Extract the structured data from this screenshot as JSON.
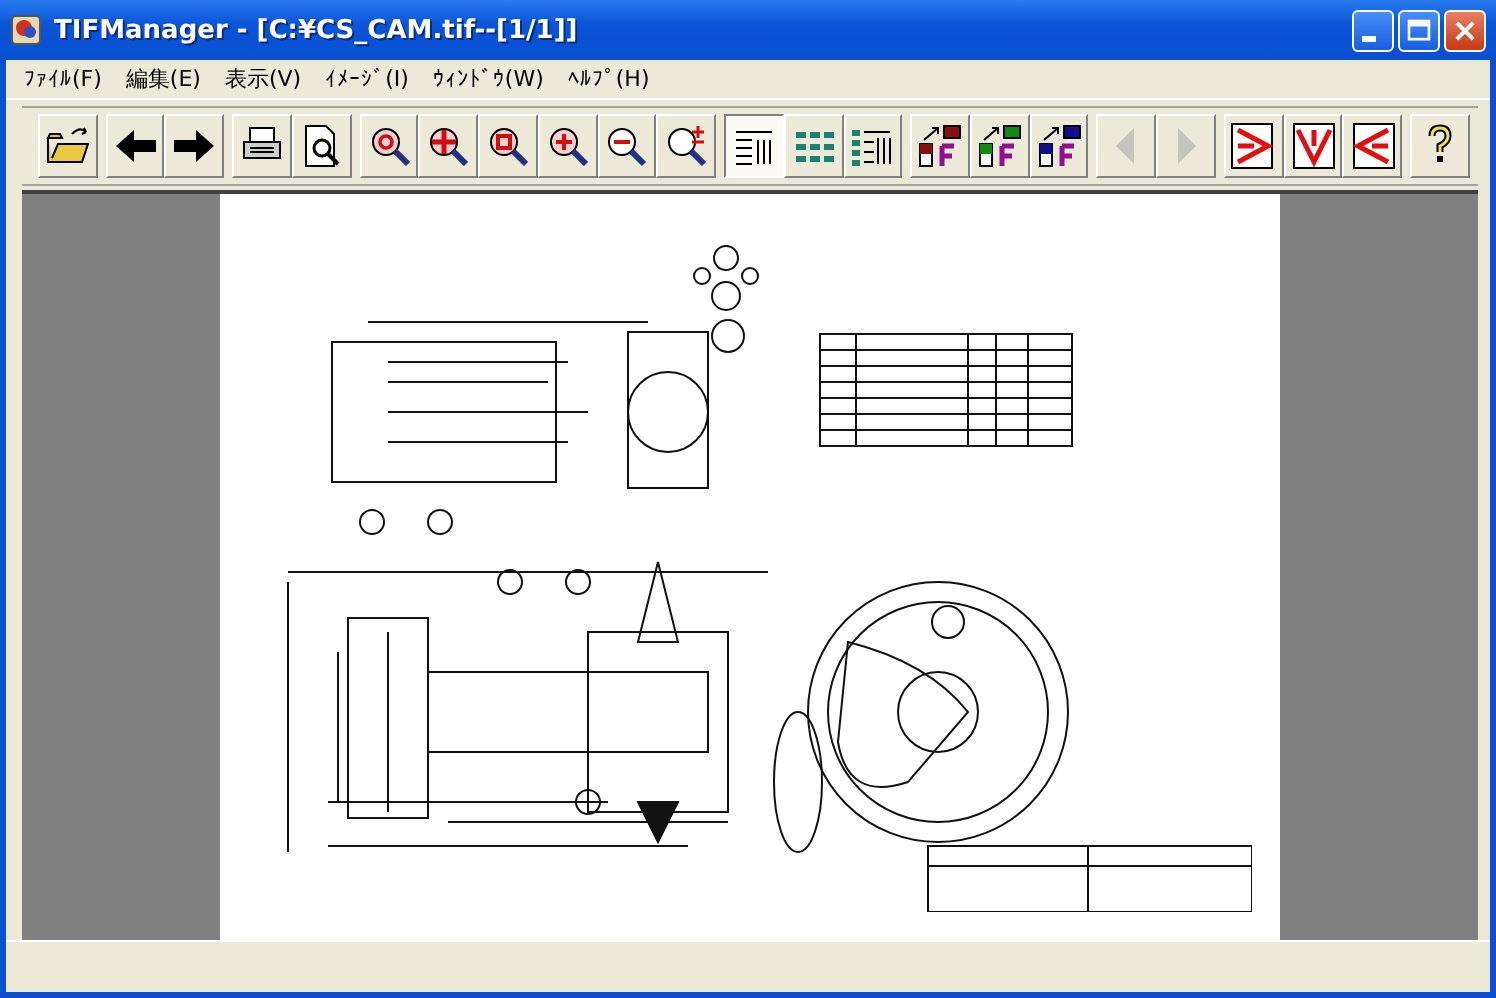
{
  "window": {
    "title": "TIFManager - [C:¥CS_CAM.tif--[1/1]]"
  },
  "menu": [
    "ﾌｧｲﾙ(F)",
    "編集(E)",
    "表示(V)",
    "ｲﾒｰｼﾞ(I)",
    "ｳｨﾝﾄﾞｳ(W)",
    "ﾍﾙﾌﾟ(H)"
  ],
  "toolbar_groups": [
    [
      {
        "kind": "open",
        "selected": false,
        "disabled": false
      }
    ],
    [
      {
        "kind": "back",
        "selected": false,
        "disabled": false
      },
      {
        "kind": "forward",
        "selected": false,
        "disabled": false
      }
    ],
    [
      {
        "kind": "print",
        "selected": false,
        "disabled": false
      },
      {
        "kind": "preview",
        "selected": false,
        "disabled": false
      }
    ],
    [
      {
        "kind": "zoom-fit",
        "selected": false,
        "disabled": false
      },
      {
        "kind": "zoom-cross",
        "selected": false,
        "disabled": false
      },
      {
        "kind": "zoom-area",
        "selected": false,
        "disabled": false
      },
      {
        "kind": "zoom-in",
        "selected": false,
        "disabled": false
      },
      {
        "kind": "zoom-out",
        "selected": false,
        "disabled": false
      },
      {
        "kind": "zoom-free",
        "selected": false,
        "disabled": false
      }
    ],
    [
      {
        "kind": "list",
        "selected": true,
        "disabled": false
      },
      {
        "kind": "grid",
        "selected": false,
        "disabled": false
      },
      {
        "kind": "detail",
        "selected": false,
        "disabled": false
      }
    ],
    [
      {
        "kind": "tone-red",
        "selected": false,
        "disabled": false
      },
      {
        "kind": "tone-green",
        "selected": false,
        "disabled": false
      },
      {
        "kind": "tone-blue",
        "selected": false,
        "disabled": false
      }
    ],
    [
      {
        "kind": "prev",
        "selected": false,
        "disabled": true
      },
      {
        "kind": "next",
        "selected": false,
        "disabled": true
      }
    ],
    [
      {
        "kind": "rotate-right",
        "selected": false,
        "disabled": false
      },
      {
        "kind": "rotate-down",
        "selected": false,
        "disabled": false
      },
      {
        "kind": "rotate-left",
        "selected": false,
        "disabled": false
      }
    ],
    [
      {
        "kind": "help",
        "selected": false,
        "disabled": false
      }
    ]
  ]
}
